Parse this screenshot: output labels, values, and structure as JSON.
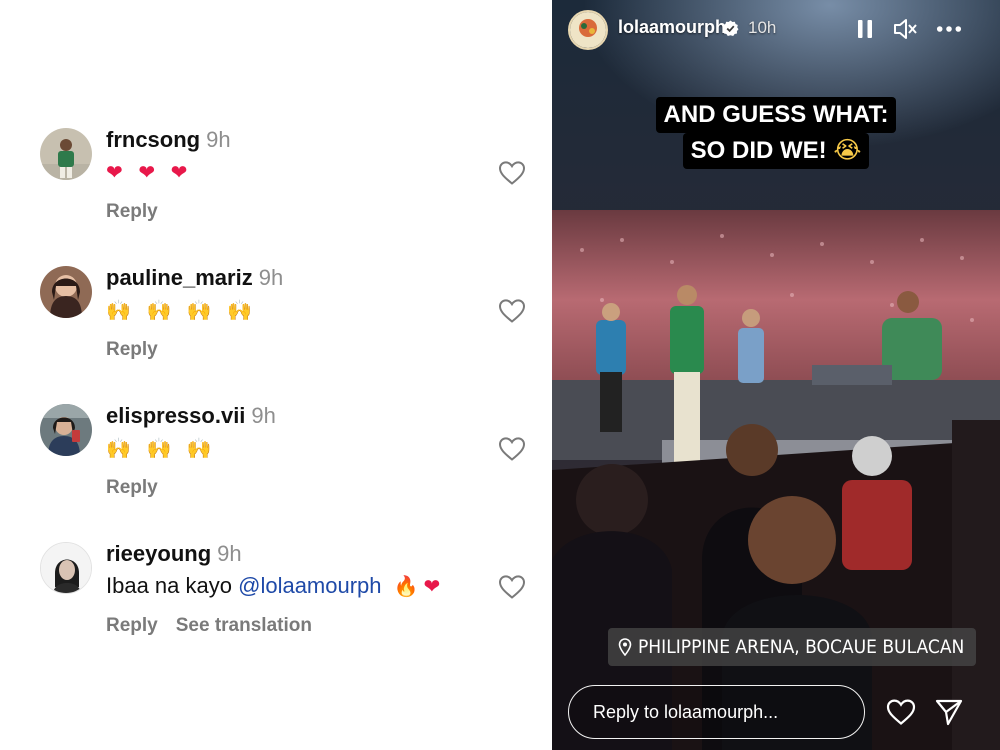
{
  "comments": [
    {
      "username": "frncsong",
      "time": "9h",
      "text": "",
      "emoji": "❤ ❤ ❤",
      "emoji_style": "red",
      "actions": [
        "Reply"
      ]
    },
    {
      "username": "pauline_mariz",
      "time": "9h",
      "text": "",
      "emoji": "🙌 🙌 🙌 🙌",
      "emoji_style": "yellow",
      "actions": [
        "Reply"
      ]
    },
    {
      "username": "elispresso.vii",
      "time": "9h",
      "text": "",
      "emoji": "🙌 🙌 🙌",
      "emoji_style": "yellow",
      "actions": [
        "Reply"
      ]
    },
    {
      "username": "rieeyoung",
      "time": "9h",
      "text": "Ibaa na kayo ",
      "mention": "@lolaamourph",
      "emoji_fire": "🔥",
      "emoji_heart": "❤",
      "actions": [
        "Reply",
        "See translation"
      ]
    }
  ],
  "icons": {
    "like": "heart-outline-icon",
    "story_controls": [
      "pause-icon",
      "mute-icon",
      "more-icon"
    ],
    "verified": "verified-badge-icon",
    "location": "location-pin-icon",
    "send": "send-icon"
  },
  "story": {
    "username": "lolaamourph",
    "time": "10h",
    "caption_line1": "AND GUESS WHAT:",
    "caption_line2": "SO DID WE!",
    "caption_emoji": "😭",
    "location": "PHILIPPINE ARENA, BOCAUE BULACAN",
    "reply_placeholder": "Reply to lolaamourph..."
  },
  "colors": {
    "username": "#111111",
    "meta": "#8e8e8e",
    "mention": "#1f4aa8",
    "heart_red": "#e8184a",
    "story_overlay_bg": "#000000"
  }
}
